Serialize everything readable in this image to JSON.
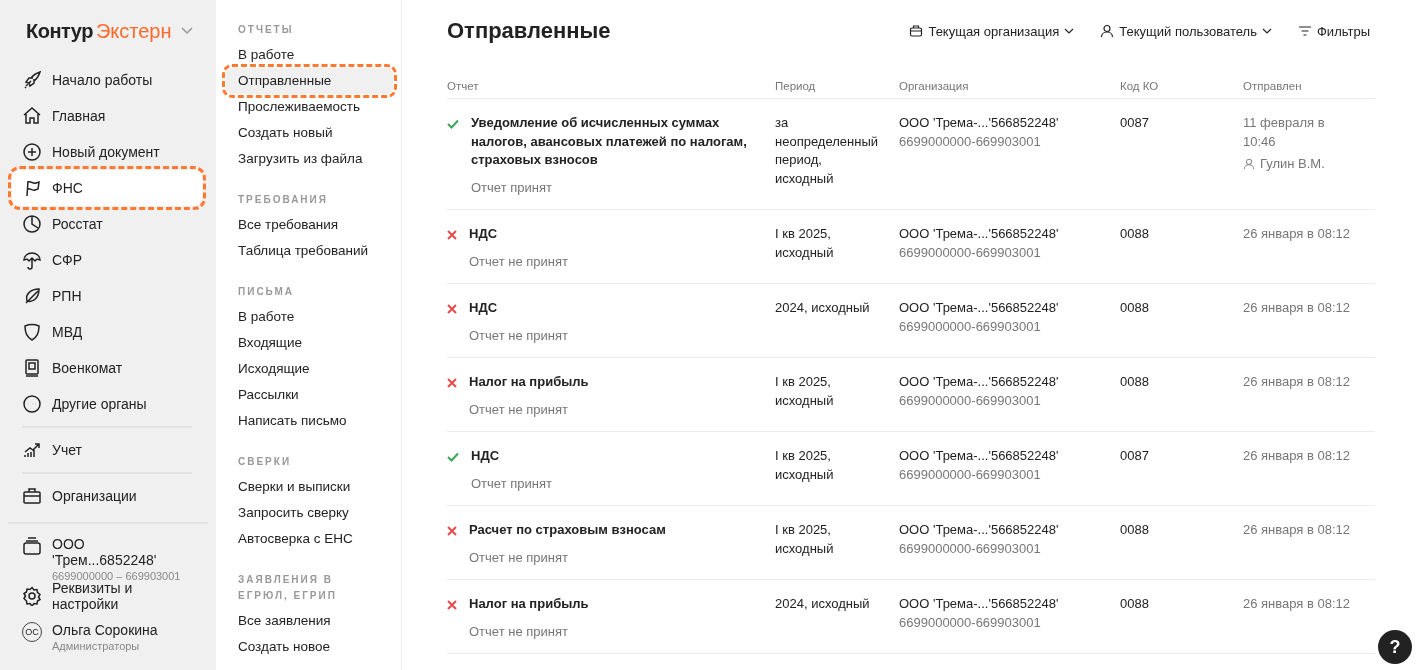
{
  "logo": {
    "brand": "Контур",
    "product": "Экстерн"
  },
  "nav": {
    "items": [
      {
        "label": "Начало работы",
        "selected": false,
        "highlighted": false
      },
      {
        "label": "Главная",
        "selected": false,
        "highlighted": false
      },
      {
        "label": "Новый документ",
        "selected": false,
        "highlighted": false
      },
      {
        "label": "ФНС",
        "selected": true,
        "highlighted": true
      },
      {
        "label": "Росстат",
        "selected": false,
        "highlighted": false
      },
      {
        "label": "СФР",
        "selected": false,
        "highlighted": false
      },
      {
        "label": "РПН",
        "selected": false,
        "highlighted": false
      },
      {
        "label": "МВД",
        "selected": false,
        "highlighted": false
      },
      {
        "label": "Военкомат",
        "selected": false,
        "highlighted": false
      },
      {
        "label": "Другие органы",
        "selected": false,
        "highlighted": false
      }
    ],
    "accounting": "Учет",
    "organizations": "Организации",
    "org": {
      "name": "ООО 'Трем...6852248'",
      "ids": "6699000000 – 669903001"
    },
    "settings": "Реквизиты и настройки",
    "user": {
      "initials": "ОС",
      "name": "Ольга Сорокина",
      "role": "Администраторы"
    }
  },
  "subnav": [
    {
      "title": "ОТЧЕТЫ",
      "items": [
        {
          "label": "В работе",
          "selected": false,
          "highlighted": false
        },
        {
          "label": "Отправленные",
          "selected": true,
          "highlighted": true
        },
        {
          "label": "Прослеживаемость",
          "selected": false,
          "highlighted": false
        },
        {
          "label": "Создать новый",
          "selected": false,
          "highlighted": false
        },
        {
          "label": "Загрузить из файла",
          "selected": false,
          "highlighted": false
        }
      ]
    },
    {
      "title": "ТРЕБОВАНИЯ",
      "items": [
        {
          "label": "Все требования",
          "selected": false,
          "highlighted": false
        },
        {
          "label": "Таблица требований",
          "selected": false,
          "highlighted": false
        }
      ]
    },
    {
      "title": "ПИСЬМА",
      "items": [
        {
          "label": "В работе",
          "selected": false,
          "highlighted": false
        },
        {
          "label": "Входящие",
          "selected": false,
          "highlighted": false
        },
        {
          "label": "Исходящие",
          "selected": false,
          "highlighted": false
        },
        {
          "label": "Рассылки",
          "selected": false,
          "highlighted": false
        },
        {
          "label": "Написать письмо",
          "selected": false,
          "highlighted": false
        }
      ]
    },
    {
      "title": "СВЕРКИ",
      "items": [
        {
          "label": "Сверки и выписки",
          "selected": false,
          "highlighted": false
        },
        {
          "label": "Запросить сверку",
          "selected": false,
          "highlighted": false
        },
        {
          "label": "Автосверка с ЕНС",
          "selected": false,
          "highlighted": false
        }
      ]
    },
    {
      "title": "ЗАЯВЛЕНИЯ В ЕГРЮЛ, ЕГРИП",
      "items": [
        {
          "label": "Все заявления",
          "selected": false,
          "highlighted": false
        },
        {
          "label": "Создать новое",
          "selected": false,
          "highlighted": false
        }
      ]
    }
  ],
  "page": {
    "title": "Отправленные",
    "filters": [
      "Текущая организация",
      "Текущий пользователь",
      "Фильтры"
    ]
  },
  "table": {
    "columns": [
      "Отчет",
      "Период",
      "Организация",
      "Код КО",
      "Отправлен"
    ],
    "rows": [
      {
        "kind": "accepted",
        "report": "Уведомление об исчисленных суммах налогов, авансовых платежей по налогам, страховых взносов",
        "status": "Отчет принят",
        "period": "за неопределенный период, исходный",
        "org": "ООО 'Трема-...'566852248'",
        "org_ids": "6699000000-669903001",
        "code": "0087",
        "sent": "11 февраля в 10:46",
        "sender": "Гулин В.М."
      },
      {
        "kind": "rejected",
        "report": "НДС",
        "status": "Отчет не принят",
        "period": "I кв 2025, исходный",
        "org": "ООО 'Трема-...'566852248'",
        "org_ids": "6699000000-669903001",
        "code": "0088",
        "sent": "26 января в 08:12"
      },
      {
        "kind": "rejected",
        "report": "НДС",
        "status": "Отчет не принят",
        "period": "2024, исходный",
        "org": "ООО 'Трема-...'566852248'",
        "org_ids": "6699000000-669903001",
        "code": "0088",
        "sent": "26 января в 08:12"
      },
      {
        "kind": "rejected",
        "report": "Налог на прибыль",
        "status": "Отчет не принят",
        "period": "I кв 2025, исходный",
        "org": "ООО 'Трема-...'566852248'",
        "org_ids": "6699000000-669903001",
        "code": "0088",
        "sent": "26 января в 08:12"
      },
      {
        "kind": "accepted",
        "report": "НДС",
        "status": "Отчет принят",
        "period": "I кв 2025, исходный",
        "org": "ООО 'Трема-...'566852248'",
        "org_ids": "6699000000-669903001",
        "code": "0087",
        "sent": "26 января в 08:12"
      },
      {
        "kind": "rejected",
        "report": "Расчет по страховым взносам",
        "status": "Отчет не принят",
        "period": "I кв 2025, исходный",
        "org": "ООО 'Трема-...'566852248'",
        "org_ids": "6699000000-669903001",
        "code": "0088",
        "sent": "26 января в 08:12"
      },
      {
        "kind": "rejected",
        "report": "Налог на прибыль",
        "status": "Отчет не принят",
        "period": "2024, исходный",
        "org": "ООО 'Трема-...'566852248'",
        "org_ids": "6699000000-669903001",
        "code": "0088",
        "sent": "26 января в 08:12"
      }
    ]
  },
  "help": "?"
}
